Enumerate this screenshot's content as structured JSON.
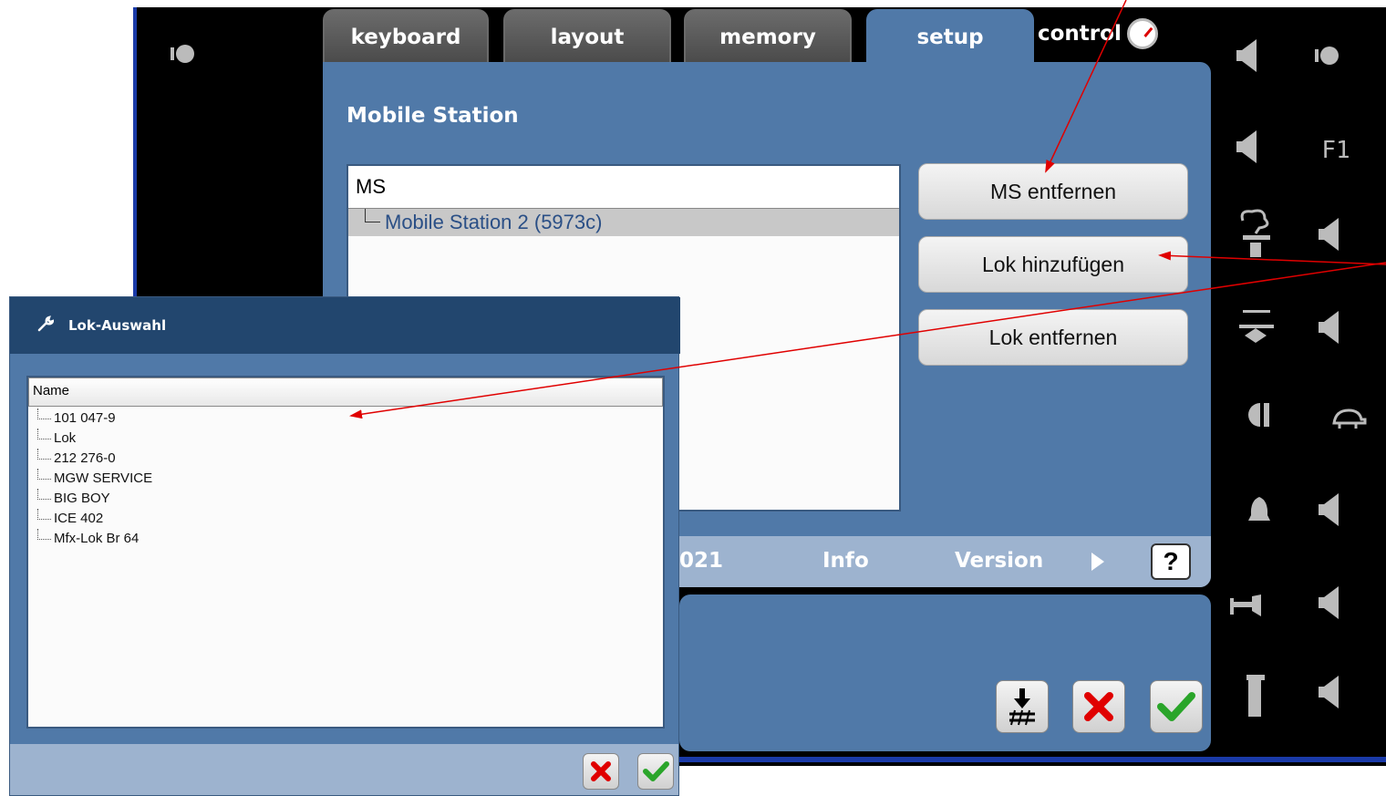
{
  "tabs": [
    {
      "label": "keyboard"
    },
    {
      "label": "layout"
    },
    {
      "label": "memory"
    },
    {
      "label": "setup",
      "active": true
    }
  ],
  "control_tab": {
    "label": "control"
  },
  "panel": {
    "title": "Mobile Station",
    "list_header": "MS",
    "list_item": "Mobile Station 2 (5973c)"
  },
  "buttons": {
    "ms_remove": "MS entfernen",
    "lok_add": "Lok hinzufügen",
    "lok_remove": "Lok entfernen"
  },
  "status_bar": {
    "left_text": "021",
    "info": "Info",
    "version": "Version",
    "help": "?"
  },
  "dialog": {
    "title": "Lok-Auswahl",
    "column_header": "Name",
    "items": [
      "101 047-9",
      "Lok",
      "212 276-0",
      "MGW SERVICE",
      "BIG BOY",
      "ICE 402",
      "Mfx-Lok Br 64"
    ]
  },
  "side_icons": {
    "f1_label": "F1"
  },
  "colors": {
    "panel_blue": "#5079a8",
    "title_bar": "#22466e",
    "arrow_red": "#e00000"
  }
}
